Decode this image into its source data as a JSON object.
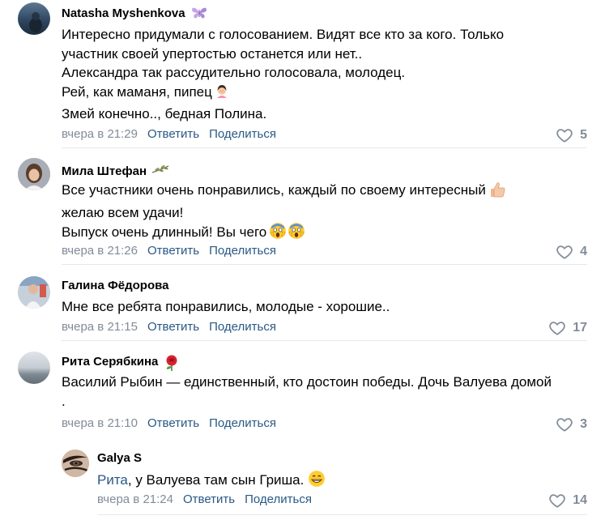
{
  "comments": [
    {
      "author": "Natasha Myshenkova",
      "badge": "butterfly-icon",
      "lines": [
        "Интересно придумали с голосованием. Видят все кто за кого. Только",
        "участник своей упертостью останется или нет..",
        "Александра так рассудительно голосовала, молодец.",
        "Рей, как маманя, пипец",
        "Змей конечно.., бедная Полина."
      ],
      "time": "вчера в 21:29",
      "reply_label": "Ответить",
      "share_label": "Поделиться",
      "likes": "5"
    },
    {
      "author": "Мила Штефан",
      "badge": "branch-icon",
      "lines": [
        "Все участники очень понравились, каждый по своему интересный",
        "желаю всем удачи!",
        "Выпуск очень длинный! Вы чего"
      ],
      "time": "вчера в 21:26",
      "reply_label": "Ответить",
      "share_label": "Поделиться",
      "likes": "4"
    },
    {
      "author": "Галина Фёдорова",
      "lines": [
        "Мне все ребята понравились, молодые - хорошие.."
      ],
      "time": "вчера в 21:15",
      "reply_label": "Ответить",
      "share_label": "Поделиться",
      "likes": "17"
    },
    {
      "author": "Рита Серябкина",
      "badge": "rose-icon",
      "lines": [
        "Василий Рыбин — единственный, кто достоин победы. Дочь Валуева домой",
        "."
      ],
      "time": "вчера в 21:10",
      "reply_label": "Ответить",
      "share_label": "Поделиться",
      "likes": "3"
    }
  ],
  "reply": {
    "author": "Galya S",
    "mention": "Рита",
    "text": ", у Валуева там сын Гриша.",
    "time": "вчера в 21:24",
    "reply_label": "Ответить",
    "share_label": "Поделиться",
    "likes": "14"
  },
  "colors": {
    "link": "#2a5885",
    "meta": "#818c99",
    "divider": "#e7e8ec"
  }
}
